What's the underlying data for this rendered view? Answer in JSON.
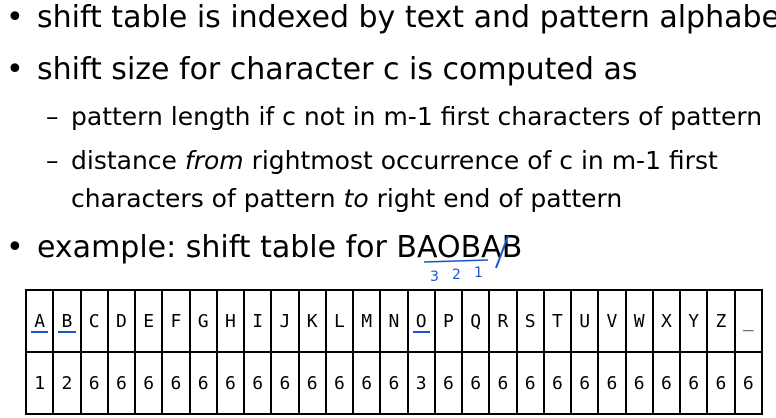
{
  "bullets": [
    {
      "text": "shift table is indexed by text and pattern alphabet"
    },
    {
      "text": "shift size for character c is computed as"
    },
    {
      "text_before": "example: shift table for BAOBA",
      "text_struck": "B"
    }
  ],
  "sub_bullets": [
    {
      "line1": "pattern length if c not in m-1 first characters of pattern"
    },
    {
      "line1_a": "distance ",
      "line1_em": "from",
      "line1_b": " rightmost occurrence of c in m-1 first",
      "line2_a": "characters of pattern ",
      "line2_em": "to",
      "line2_b": " right end of pattern"
    }
  ],
  "glyphs": {
    "bullet": "•",
    "dash": "–"
  },
  "annotations": {
    "digits": [
      "3",
      "2",
      "1"
    ],
    "ink_color": "#1a56c8"
  },
  "table": {
    "characters": [
      "A",
      "B",
      "C",
      "D",
      "E",
      "F",
      "G",
      "H",
      "I",
      "J",
      "K",
      "L",
      "M",
      "N",
      "O",
      "P",
      "Q",
      "R",
      "S",
      "T",
      "U",
      "V",
      "W",
      "X",
      "Y",
      "Z",
      "_"
    ],
    "shifts": [
      "1",
      "2",
      "6",
      "6",
      "6",
      "6",
      "6",
      "6",
      "6",
      "6",
      "6",
      "6",
      "6",
      "6",
      "3",
      "6",
      "6",
      "6",
      "6",
      "6",
      "6",
      "6",
      "6",
      "6",
      "6",
      "6",
      "6"
    ],
    "underlined": [
      "A",
      "B",
      "O"
    ]
  }
}
